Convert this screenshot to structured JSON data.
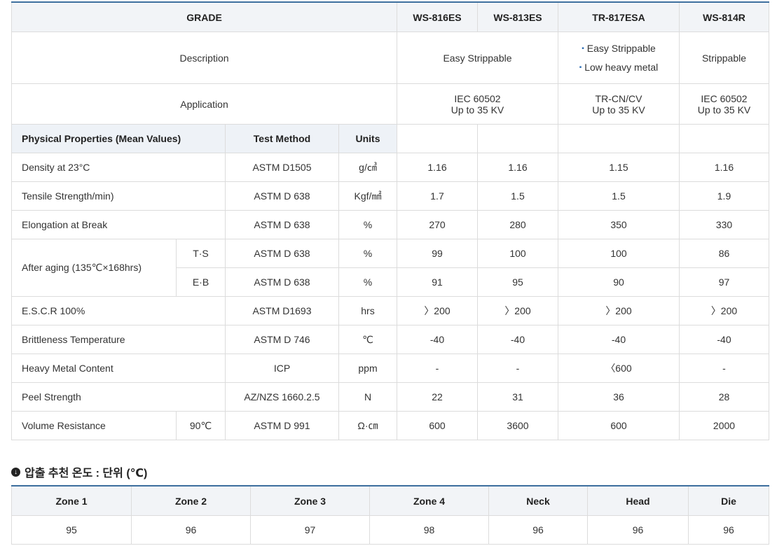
{
  "spec": {
    "grade_label": "GRADE",
    "grades": [
      "WS-816ES",
      "WS-813ES",
      "TR-817ESA",
      "WS-814R"
    ],
    "description_label": "Description",
    "desc_ws816_813": "Easy  Strippable",
    "desc_tr817_lines": [
      "Easy Strippable",
      "Low heavy metal"
    ],
    "desc_ws814": "Strippable",
    "application_label": "Application",
    "app_ws816_813": [
      "IEC 60502",
      "Up to 35 KV"
    ],
    "app_tr817": [
      "TR-CN/CV",
      "Up to 35 KV"
    ],
    "app_ws814": [
      "IEC 60502",
      "Up to 35 KV"
    ],
    "prop_header": "Physical Properties (Mean Values)",
    "test_method_header": "Test Method",
    "units_header": "Units",
    "rows": [
      {
        "property": "Density at 23°C",
        "sub": "",
        "method": "ASTM D1505",
        "unit": "g/㎤",
        "values": [
          "1.16",
          "1.16",
          "1.15",
          "1.16"
        ]
      },
      {
        "property": "Tensile Strength/min)",
        "sub": "",
        "method": "ASTM D 638",
        "unit": "Kgf/㎟",
        "values": [
          "1.7",
          "1.5",
          "1.5",
          "1.9"
        ]
      },
      {
        "property": "Elongation at Break",
        "sub": "",
        "method": "ASTM D 638",
        "unit": "%",
        "values": [
          "270",
          "280",
          "350",
          "330"
        ]
      },
      {
        "property": "After aging (135℃×168hrs)",
        "sub": "T·S",
        "method": "ASTM D 638",
        "unit": "%",
        "values": [
          "99",
          "100",
          "100",
          "86"
        ]
      },
      {
        "property": "",
        "sub": "E·B",
        "method": "ASTM D 638",
        "unit": "%",
        "values": [
          "91",
          "95",
          "90",
          "97"
        ]
      },
      {
        "property": "E.S.C.R 100%",
        "sub": "",
        "method": "ASTM D1693",
        "unit": "hrs",
        "values": [
          "〉200",
          "〉200",
          "〉200",
          "〉200"
        ]
      },
      {
        "property": "Brittleness Temperature",
        "sub": "",
        "method": "ASTM D 746",
        "unit": "℃",
        "values": [
          "-40",
          "-40",
          "-40",
          "-40"
        ]
      },
      {
        "property": "Heavy Metal Content",
        "sub": "",
        "method": "ICP",
        "unit": "ppm",
        "values": [
          "-",
          "-",
          "〈600",
          "-"
        ]
      },
      {
        "property": "Peel Strength",
        "sub": "",
        "method": "AZ/NZS 1660.2.5",
        "unit": "N",
        "values": [
          "22",
          "31",
          "36",
          "28"
        ]
      },
      {
        "property": "Volume Resistance",
        "sub": "90℃",
        "method": "ASTM D 991",
        "unit": "Ω·㎝",
        "values": [
          "600",
          "3600",
          "600",
          "2000"
        ]
      }
    ]
  },
  "section": {
    "icon": "arrow-down-circle-icon",
    "title": "압출 추천 온도 : 단위 (℃)"
  },
  "zones": {
    "headers": [
      "Zone 1",
      "Zone 2",
      "Zone 3",
      "Zone 4",
      "Neck",
      "Head",
      "Die"
    ],
    "values": [
      "95",
      "96",
      "97",
      "98",
      "96",
      "96",
      "96"
    ]
  }
}
